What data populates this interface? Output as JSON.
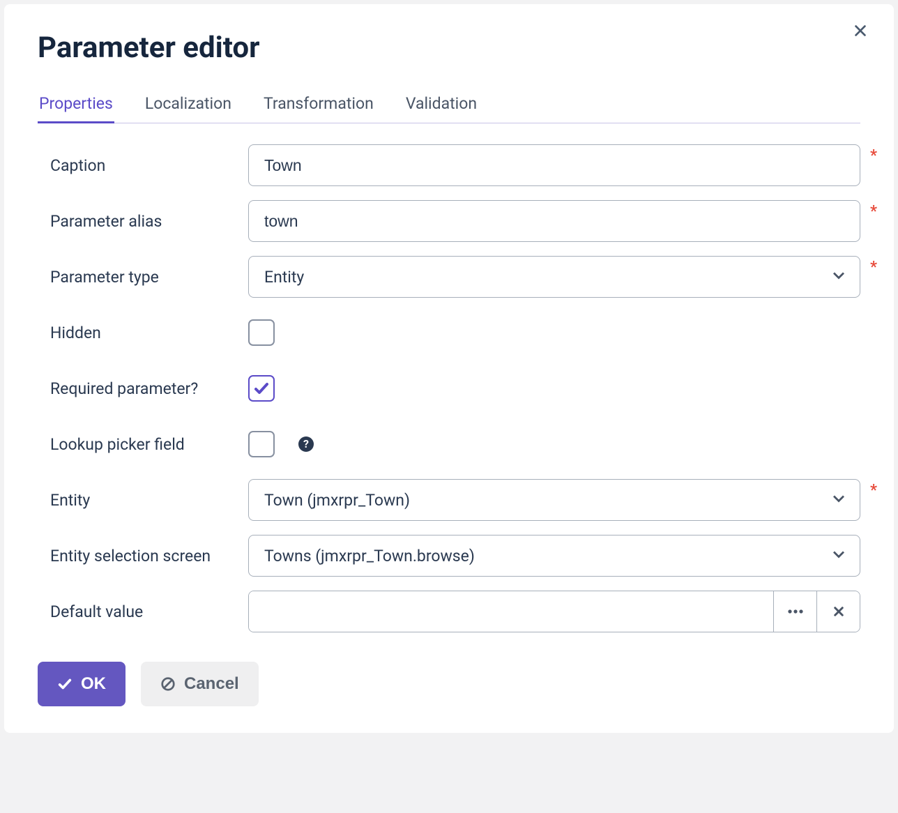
{
  "dialog": {
    "title": "Parameter editor"
  },
  "tabs": {
    "items": [
      {
        "label": "Properties"
      },
      {
        "label": "Localization"
      },
      {
        "label": "Transformation"
      },
      {
        "label": "Validation"
      }
    ]
  },
  "form": {
    "caption": {
      "label": "Caption",
      "value": "Town"
    },
    "alias": {
      "label": "Parameter alias",
      "value": "town"
    },
    "type": {
      "label": "Parameter type",
      "value": "Entity"
    },
    "hidden": {
      "label": "Hidden",
      "checked": false
    },
    "required": {
      "label": "Required parameter?",
      "checked": true
    },
    "lookup": {
      "label": "Lookup picker field",
      "checked": false
    },
    "entity": {
      "label": "Entity",
      "value": "Town (jmxrpr_Town)"
    },
    "selectionScreen": {
      "label": "Entity selection screen",
      "value": "Towns (jmxrpr_Town.browse)"
    },
    "defaultValue": {
      "label": "Default value",
      "value": ""
    }
  },
  "buttons": {
    "ok": "OK",
    "cancel": "Cancel"
  }
}
